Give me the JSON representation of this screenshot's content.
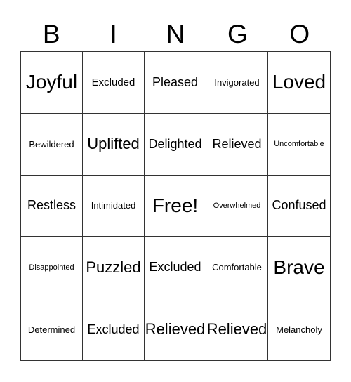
{
  "header": {
    "letters": [
      "B",
      "I",
      "N",
      "G",
      "O"
    ]
  },
  "grid": {
    "cells": [
      {
        "text": "Joyful",
        "size": "xl"
      },
      {
        "text": "Excluded",
        "size": "ms"
      },
      {
        "text": "Pleased",
        "size": "m"
      },
      {
        "text": "Invigorated",
        "size": "s"
      },
      {
        "text": "Loved",
        "size": "xl"
      },
      {
        "text": "Bewildered",
        "size": "s"
      },
      {
        "text": "Uplifted",
        "size": "l"
      },
      {
        "text": "Delighted",
        "size": "m"
      },
      {
        "text": "Relieved",
        "size": "m"
      },
      {
        "text": "Uncomfortable",
        "size": "xs"
      },
      {
        "text": "Restless",
        "size": "m"
      },
      {
        "text": "Intimidated",
        "size": "s"
      },
      {
        "text": "Free!",
        "size": "xl"
      },
      {
        "text": "Overwhelmed",
        "size": "xs"
      },
      {
        "text": "Confused",
        "size": "m"
      },
      {
        "text": "Disappointed",
        "size": "xs"
      },
      {
        "text": "Puzzled",
        "size": "l"
      },
      {
        "text": "Excluded",
        "size": "m"
      },
      {
        "text": "Comfortable",
        "size": "s"
      },
      {
        "text": "Brave",
        "size": "xl"
      },
      {
        "text": "Determined",
        "size": "s"
      },
      {
        "text": "Excluded",
        "size": "m"
      },
      {
        "text": "Relieved",
        "size": "l"
      },
      {
        "text": "Relieved",
        "size": "l"
      },
      {
        "text": "Melancholy",
        "size": "s"
      }
    ]
  }
}
